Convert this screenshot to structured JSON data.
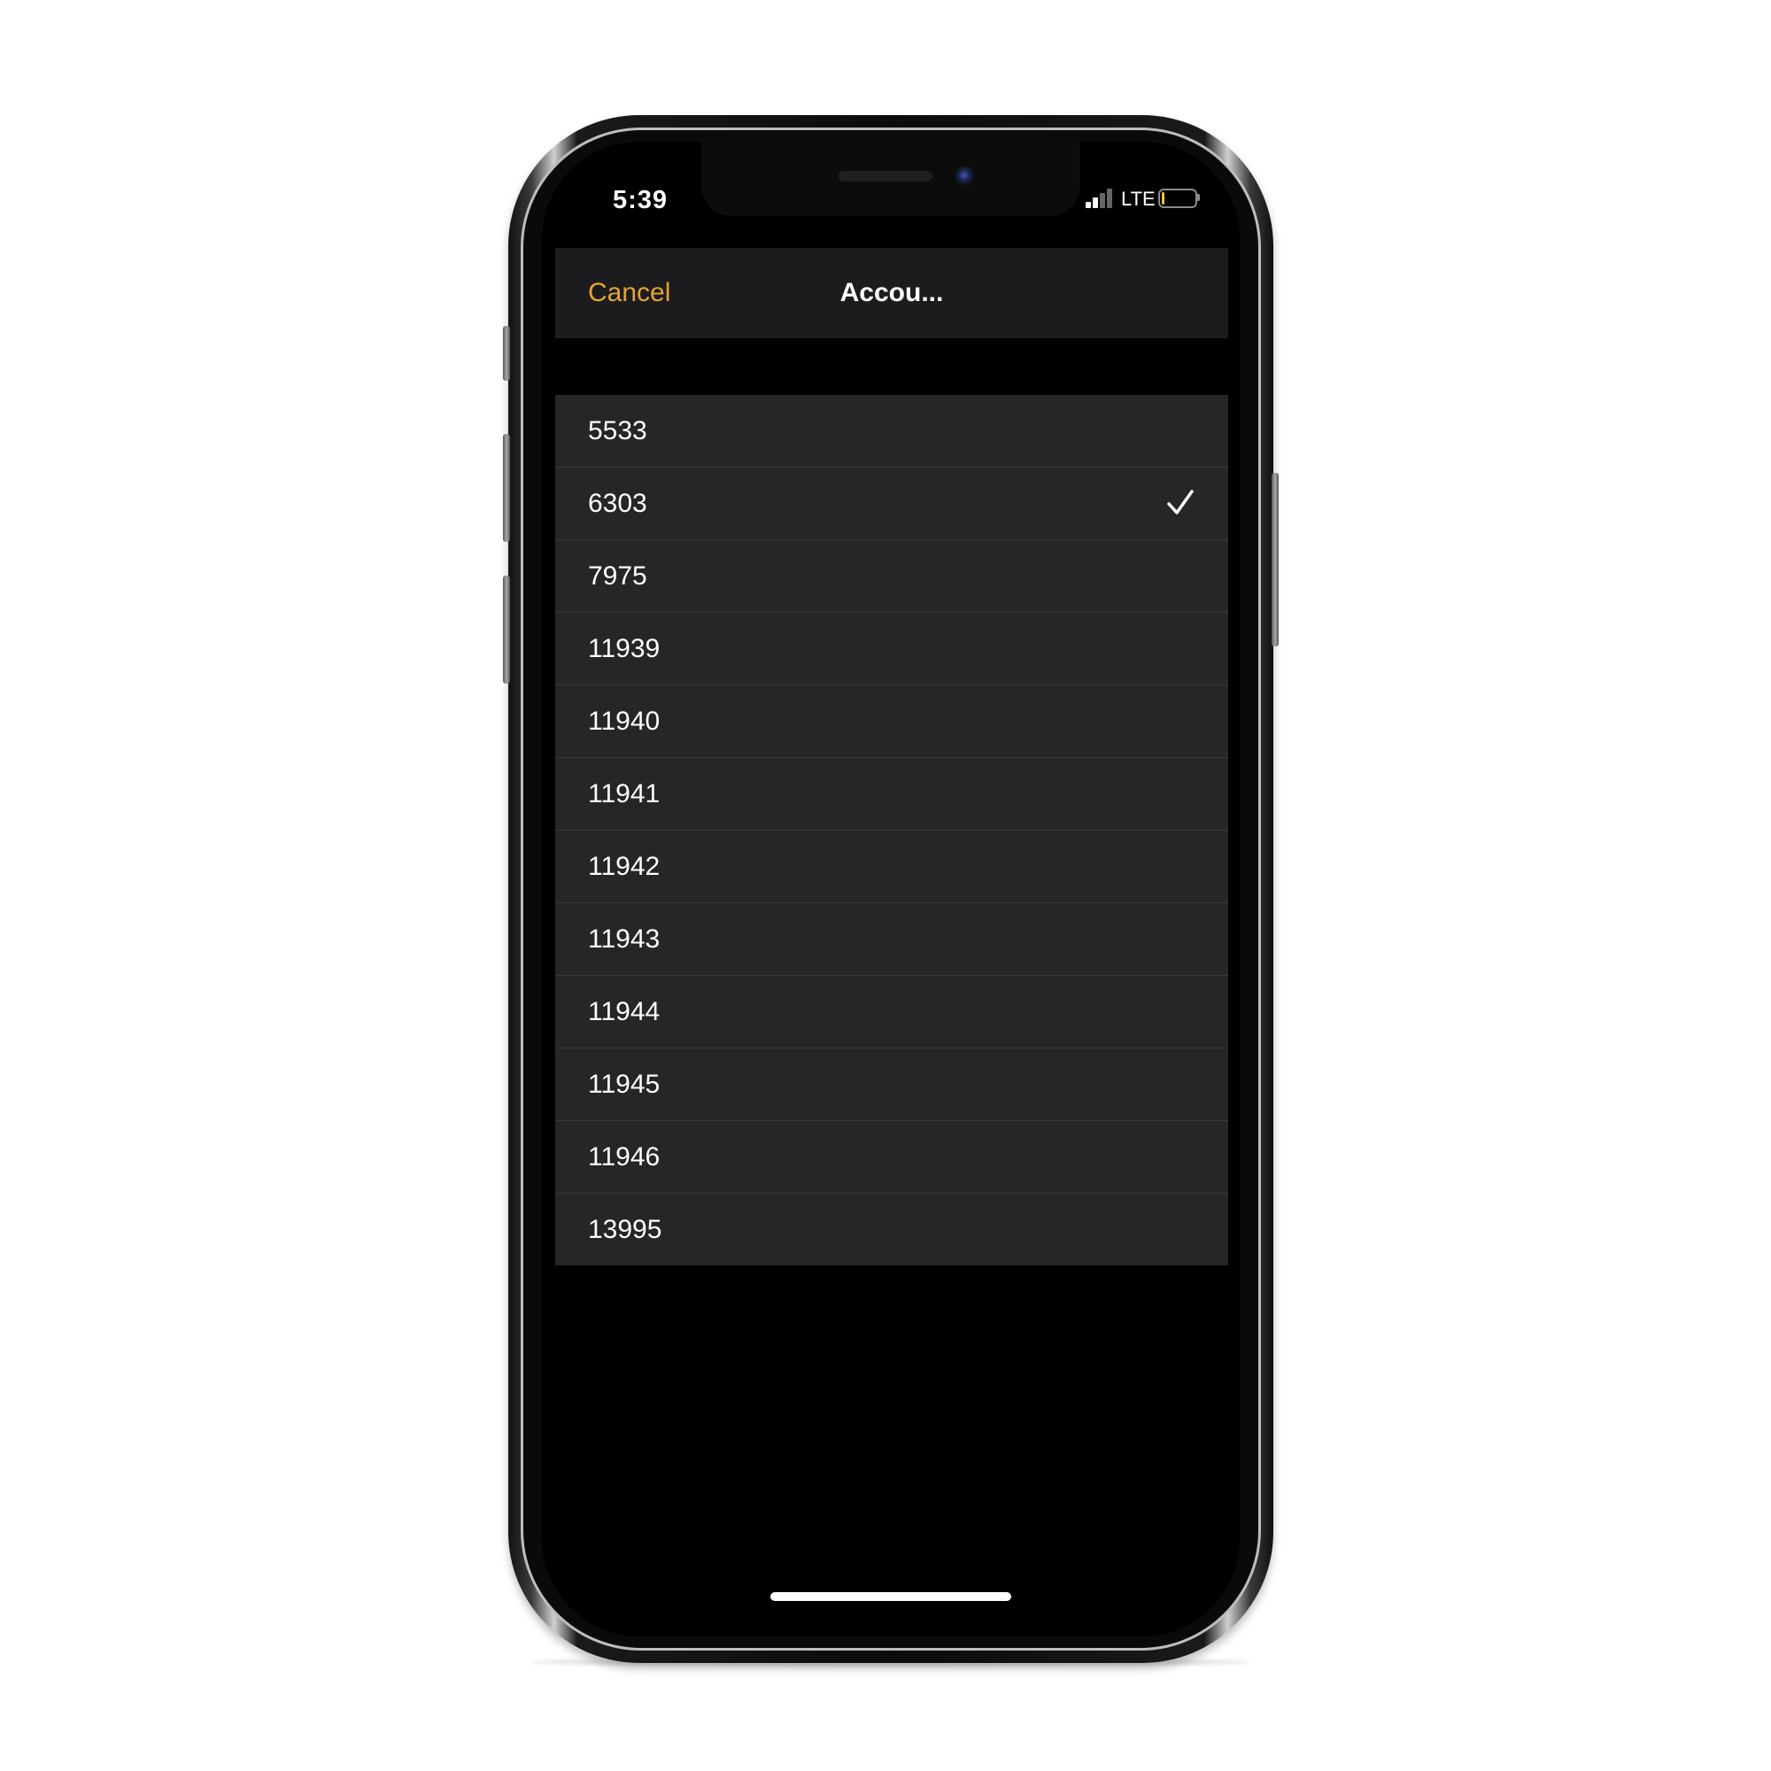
{
  "status_bar": {
    "time": "5:39",
    "network": "LTE",
    "signal_bars_active": 2,
    "signal_bars_total": 4,
    "battery_level": 0.1,
    "battery_color": "#f2c230"
  },
  "nav": {
    "cancel_label": "Cancel",
    "title": "Accou..."
  },
  "accent_color": "#e2a535",
  "accounts": [
    {
      "label": "5533",
      "selected": false
    },
    {
      "label": "6303",
      "selected": true
    },
    {
      "label": "7975",
      "selected": false
    },
    {
      "label": "11939",
      "selected": false
    },
    {
      "label": "11940",
      "selected": false
    },
    {
      "label": "11941",
      "selected": false
    },
    {
      "label": "11942",
      "selected": false
    },
    {
      "label": "11943",
      "selected": false
    },
    {
      "label": "11944",
      "selected": false
    },
    {
      "label": "11945",
      "selected": false
    },
    {
      "label": "11946",
      "selected": false
    },
    {
      "label": "13995",
      "selected": false
    }
  ],
  "icons": {
    "selected_indicator": "checkmark-icon"
  }
}
